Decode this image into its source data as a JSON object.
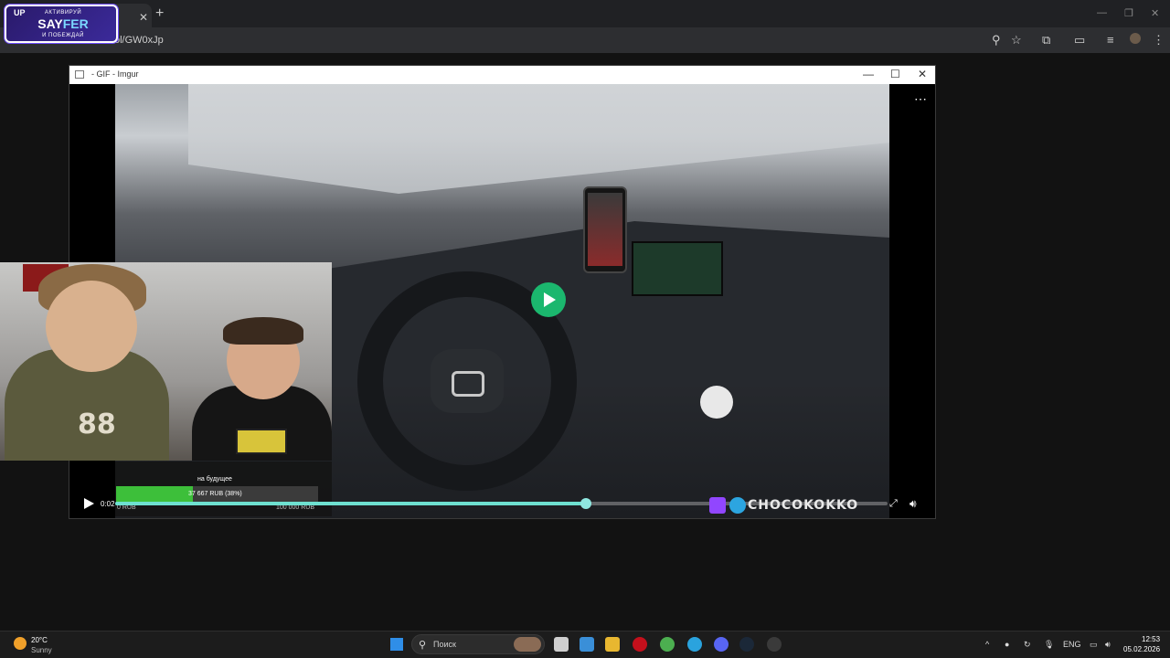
{
  "browser": {
    "url": "s.lol/GW0xJp",
    "new_tab_icon": "plus-icon",
    "close_tab_icon": "close-icon"
  },
  "overlay_logo": {
    "badge": "UP",
    "top_text": "АКТИВИРУЙ",
    "brand_a": "SAY",
    "brand_b": "FER",
    "bottom_text": "И ПОБЕЖДАЙ"
  },
  "viewer": {
    "title": "- GIF - Imgur",
    "minimize": "—",
    "maximize": "☐",
    "close": "✕",
    "more": "⋯"
  },
  "donation": {
    "title": "на будущее",
    "value": "37 667 RUB (38%)",
    "progress": 0.38,
    "min_label": "0 RUB",
    "max_label": "100 000 RUB"
  },
  "player": {
    "time": "0:02",
    "progress": 0.61,
    "watermark": "CHOCOKOKKO"
  },
  "taskbar": {
    "temperature": "20°C",
    "weather": "Sunny",
    "search_placeholder": "Поиск",
    "language": "ENG",
    "time": "12:53",
    "date": "05.02.2026"
  }
}
